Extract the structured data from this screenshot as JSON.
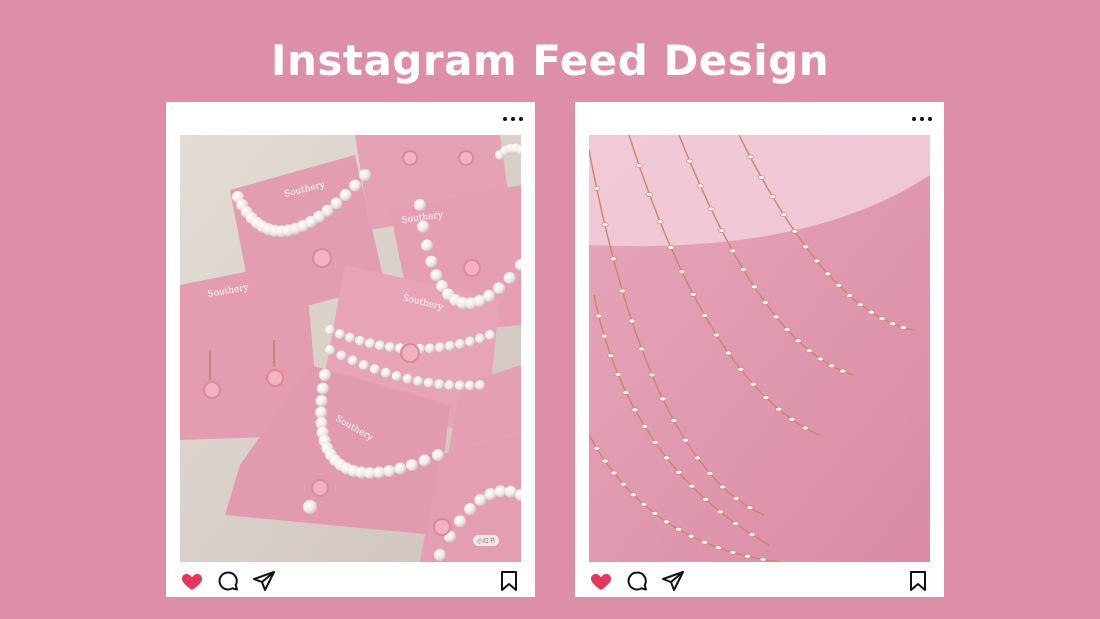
{
  "page": {
    "title": "Instagram Feed Design",
    "background_color": "#de8fa8"
  },
  "posts": [
    {
      "image_description": "pearl-jewelry-on-pink-cards",
      "card_brand_text": "Southery",
      "watermark_badge": "小红书",
      "actions": [
        "heart-icon",
        "comment-icon",
        "share-icon",
        "bookmark-icon"
      ],
      "liked": true,
      "like_color": "#e8355c"
    },
    {
      "image_description": "crystal-chain-necklaces-on-pink",
      "actions": [
        "heart-icon",
        "comment-icon",
        "share-icon",
        "bookmark-icon"
      ],
      "liked": true,
      "like_color": "#e8355c"
    }
  ]
}
